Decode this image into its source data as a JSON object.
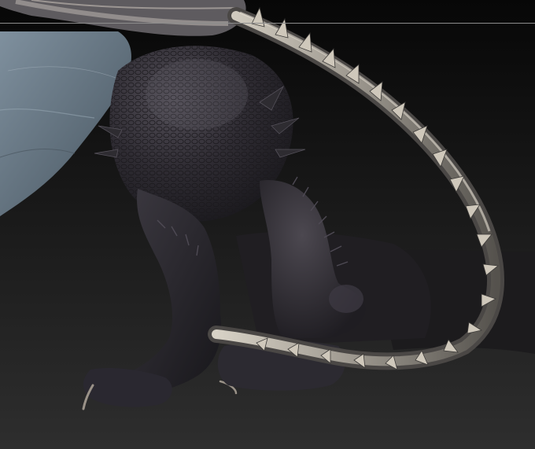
{
  "viewport": {
    "background_top": "#070707",
    "background_bottom": "#2e2e2e",
    "guide_line_color": "#8c8c8c"
  },
  "model": {
    "icon": "sculpted-creature-model",
    "wing_color": "#6f7f8c",
    "wing_dark": "#3f4b55",
    "body_color": "#2c2a30",
    "body_highlight": "#5a5660",
    "spine_color": "#8d8a85",
    "spine_highlight": "#c9c4ba",
    "claw_color": "#9a9288"
  }
}
